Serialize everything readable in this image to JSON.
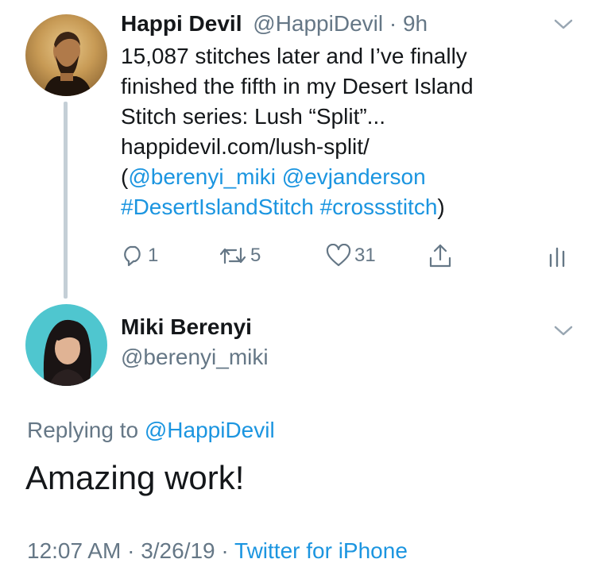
{
  "tweet": {
    "author_name": "Happi Devil",
    "handle": "@HappiDevil",
    "separator": "·",
    "time": "9h",
    "line1": "15,087 stitches later and I’ve finally",
    "line2": "finished the fifth in my Desert Island",
    "line3": "Stitch series: Lush “Split”...",
    "link": "happidevil.com/lush-split/",
    "paren_open": "(",
    "mention1": "@berenyi_miki",
    "mention2": "@evjanderson",
    "hashtag1": "#DesertIslandStitch",
    "hashtag2": "#crossstitch",
    "paren_close": ")",
    "reply_count": "1",
    "retweet_count": "5",
    "like_count": "31"
  },
  "reply": {
    "author_name": "Miki Berenyi",
    "handle": "@berenyi_miki",
    "replying_prefix": "Replying to",
    "replying_handle": "@HappiDevil",
    "text": "Amazing work!",
    "time": "12:07 AM",
    "separator": "·",
    "date": "3/26/19",
    "separator2": "·",
    "source": "Twitter for iPhone"
  },
  "icons": [
    "reply-icon",
    "retweet-icon",
    "like-icon",
    "share-icon",
    "analytics-icon",
    "chevron-down-icon"
  ],
  "colors": {
    "link_blue": "#1b95e0",
    "muted_gray": "#657786",
    "text": "#14171a",
    "thread_line": "#c4cfd6"
  }
}
